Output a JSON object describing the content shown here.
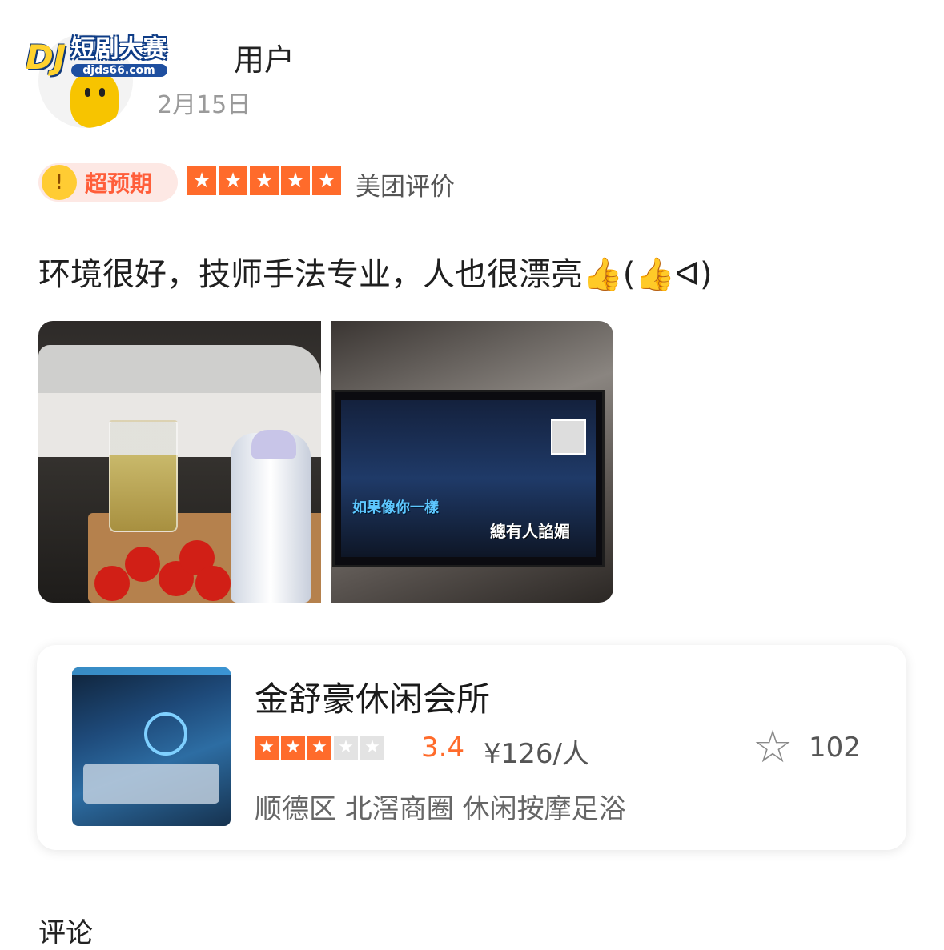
{
  "watermark": {
    "logo": "DJ",
    "title": "短剧大赛",
    "url": "djds66.com"
  },
  "user": {
    "name": "用户",
    "date": "2月15日"
  },
  "rating": {
    "badge": "超预期",
    "stars": 5,
    "source": "美团评价"
  },
  "review": {
    "text": "环境很好，技师手法专业，人也很漂亮👍(👍ᐊ)"
  },
  "photos": {
    "lyric_1": "如果像你一樣",
    "lyric_2": "總有人諂媚"
  },
  "shop": {
    "name": "金舒豪休闲会所",
    "star_rating": 3.4,
    "score": "3.4",
    "price": "¥126/人",
    "favorites": "102",
    "tags": "顺德区  北滘商圈  休闲按摩足浴"
  },
  "comments": {
    "label": "评论"
  },
  "icons": {
    "star": "★",
    "favorite": "☆"
  },
  "colors": {
    "accent": "#ff6b2b",
    "star_off": "#e3e3e3",
    "badge_bg": "#fde8e4",
    "badge_text": "#ff5e3a"
  }
}
